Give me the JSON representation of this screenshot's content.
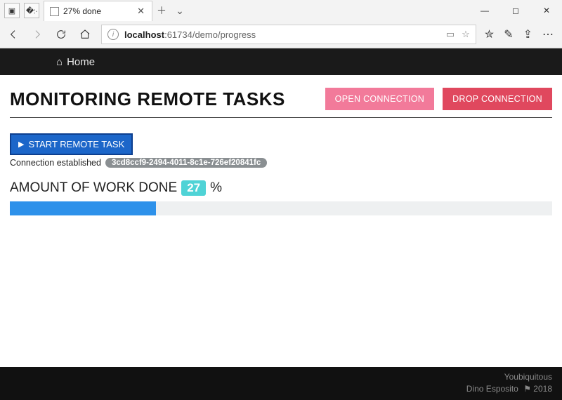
{
  "browser": {
    "tab_title": "27% done",
    "url_host": "localhost",
    "url_port": ":61734",
    "url_path": "/demo/progress"
  },
  "nav": {
    "home": "Home"
  },
  "header": {
    "title": "MONITORING REMOTE TASKS",
    "open_btn": "OPEN CONNECTION",
    "drop_btn": "DROP CONNECTION"
  },
  "start": {
    "label": "START REMOTE TASK"
  },
  "status": {
    "text": "Connection established",
    "id": "3cd8ccf9-2494-4011-8c1e-726ef20841fc"
  },
  "work": {
    "label": "AMOUNT OF WORK DONE",
    "percent": "27",
    "suffix": "%"
  },
  "progress": {
    "value": 27,
    "max": 100
  },
  "footer": {
    "line1": "Youbiquitous",
    "author": "Dino Esposito",
    "year": "2018"
  }
}
